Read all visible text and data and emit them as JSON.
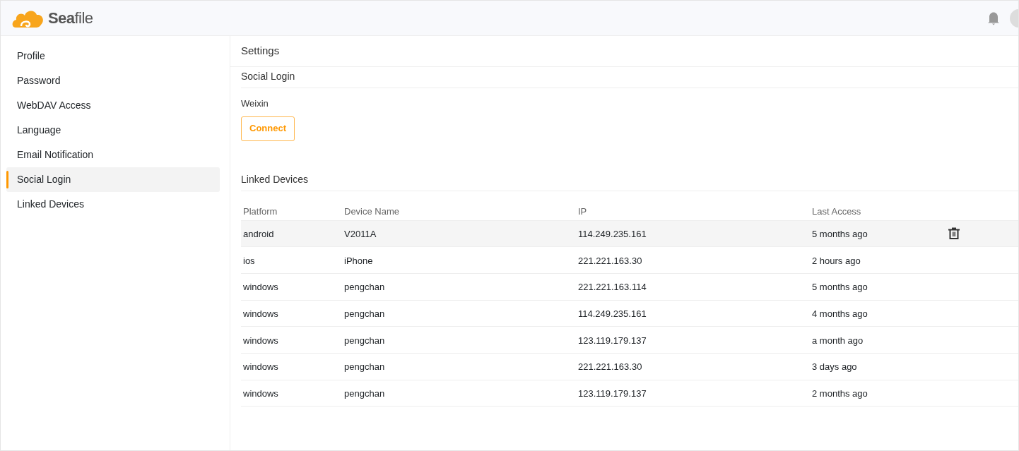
{
  "header": {
    "logo_text": "**Sea**file"
  },
  "sidebar": {
    "items": [
      {
        "label": "Profile",
        "selected": false
      },
      {
        "label": "Password",
        "selected": false
      },
      {
        "label": "WebDAV Access",
        "selected": false
      },
      {
        "label": "Language",
        "selected": false
      },
      {
        "label": "Email Notification",
        "selected": false
      },
      {
        "label": "Social Login",
        "selected": true
      },
      {
        "label": "Linked Devices",
        "selected": false
      }
    ]
  },
  "main": {
    "title": "Settings",
    "social_login": {
      "heading": "Social Login",
      "provider": "Weixin",
      "button": "Connect"
    },
    "linked_devices": {
      "heading": "Linked Devices",
      "columns": [
        "Platform",
        "Device Name",
        "IP",
        "Last Access"
      ],
      "rows": [
        {
          "platform": "android",
          "device": "V2011A",
          "ip": "114.249.235.161",
          "last_access": "5 months ago",
          "selected": true
        },
        {
          "platform": "ios",
          "device": "iPhone",
          "ip": "221.221.163.30",
          "last_access": "2 hours ago",
          "selected": false
        },
        {
          "platform": "windows",
          "device": "pengchan",
          "ip": "221.221.163.114",
          "last_access": "5 months ago",
          "selected": false
        },
        {
          "platform": "windows",
          "device": "pengchan",
          "ip": "114.249.235.161",
          "last_access": "4 months ago",
          "selected": false
        },
        {
          "platform": "windows",
          "device": "pengchan",
          "ip": "123.119.179.137",
          "last_access": "a month ago",
          "selected": false
        },
        {
          "platform": "windows",
          "device": "pengchan",
          "ip": "221.221.163.30",
          "last_access": "3 days ago",
          "selected": false
        },
        {
          "platform": "windows",
          "device": "pengchan",
          "ip": "123.119.179.137",
          "last_access": "2 months ago",
          "selected": false
        }
      ]
    }
  }
}
